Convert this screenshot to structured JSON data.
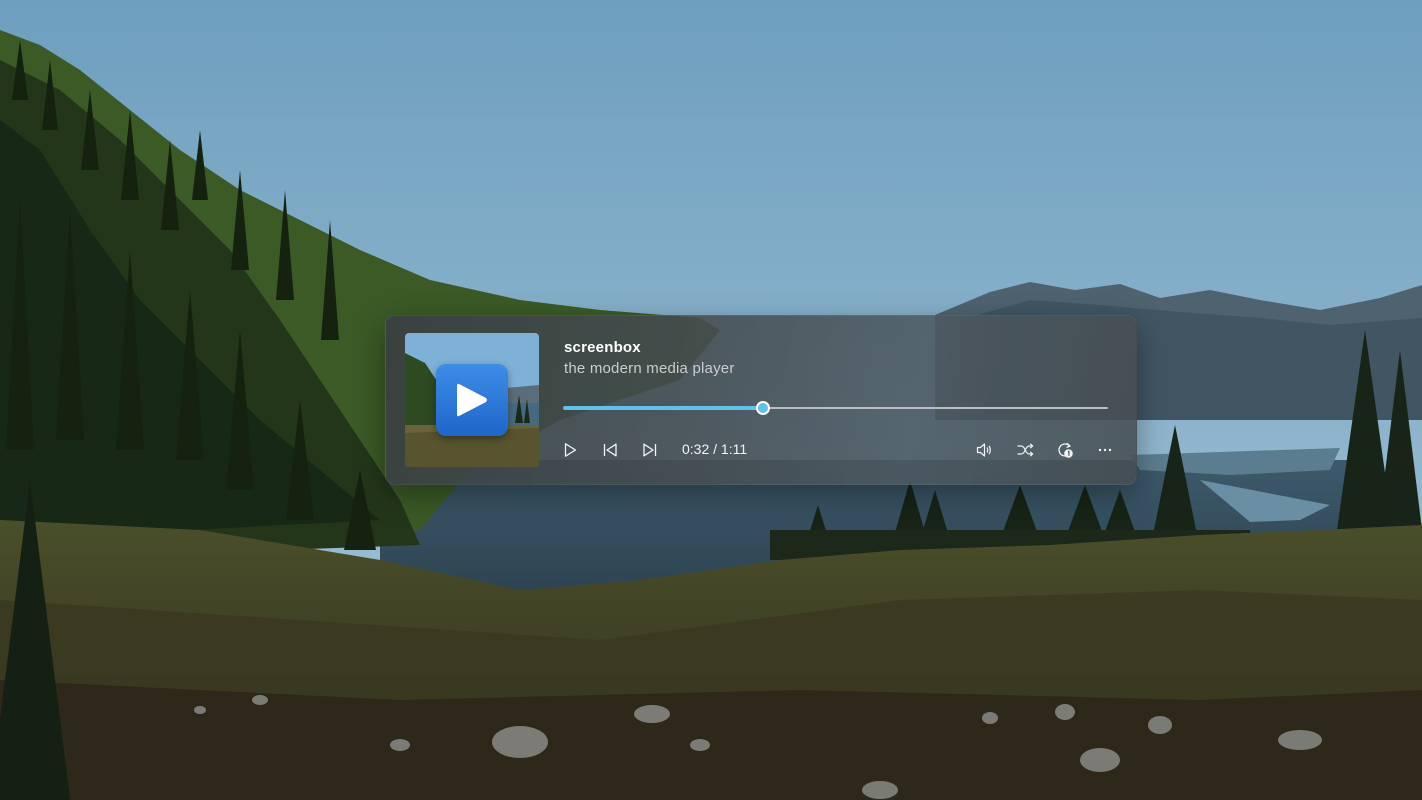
{
  "player": {
    "title": "screenbox",
    "subtitle": "the modern media player",
    "time": "0:32 / 1:11",
    "progress": 0.367,
    "accent_color": "#5cc2f0"
  },
  "controls": {
    "left": [
      "play-icon",
      "previous-icon",
      "next-icon"
    ],
    "right": [
      "volume-icon",
      "shuffle-icon",
      "repeat-one-icon",
      "more-icon"
    ]
  }
}
